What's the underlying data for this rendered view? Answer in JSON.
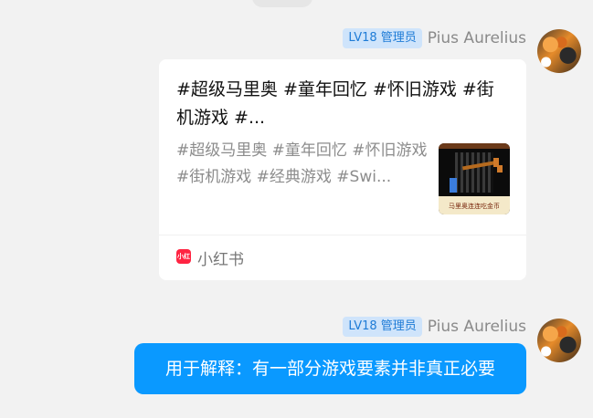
{
  "messages": [
    {
      "sender": {
        "badge": "LV18 管理员",
        "name": "Pius Aurelius"
      },
      "card": {
        "title": "#超级马里奥 #童年回忆 #怀旧游戏 #街机游戏 #...",
        "description": "#超级马里奥 #童年回忆 #怀旧游戏 #街机游戏 #经典游戏 #Swi...",
        "thumbnail_caption": "马里奥连连吃金币",
        "source": {
          "logo_text": "小红书",
          "name": "小红书"
        }
      }
    },
    {
      "sender": {
        "badge": "LV18 管理员",
        "name": "Pius Aurelius"
      },
      "text": "用于解释：有一部分游戏要素并非真正必要"
    }
  ],
  "colors": {
    "bubble": "#0a99ff",
    "badge_bg": "#cfe4fb",
    "badge_text": "#1e7bd6",
    "source_logo": "#ff2442"
  }
}
